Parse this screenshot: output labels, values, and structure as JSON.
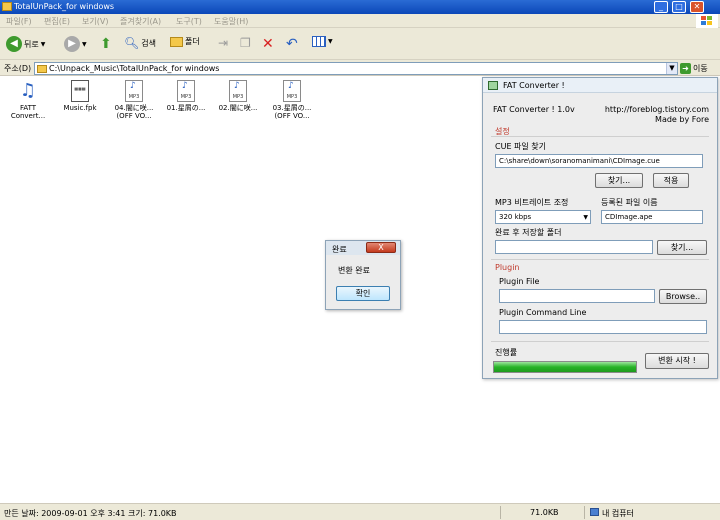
{
  "window": {
    "title": "TotalUnPack_for windows"
  },
  "menu": [
    "파일(F)",
    "편집(E)",
    "보기(V)",
    "즐겨찾기(A)",
    "도구(T)",
    "도움말(H)"
  ],
  "toolbar": {
    "back_label": "뒤로",
    "search_label": "검색",
    "folders_label": "폴더"
  },
  "address": {
    "label": "주소(D)",
    "path": "C:\\Unpack_Music\\TotalUnPack_for windows",
    "go_label": "이동"
  },
  "files": [
    {
      "name": "FATT Convert...",
      "icon": "music-notes-icon"
    },
    {
      "name": "Music.fpk",
      "icon": "fpk-file-icon"
    },
    {
      "name": "04.闇に咲...",
      "sub": "(OFF VO...",
      "icon": "mp3-file-icon"
    },
    {
      "name": "01.星屑の...",
      "icon": "mp3-file-icon"
    },
    {
      "name": "02.闇に咲...",
      "icon": "mp3-file-icon"
    },
    {
      "name": "03.星屑の...",
      "sub": "(OFF VO...",
      "icon": "mp3-file-icon"
    }
  ],
  "fat": {
    "window_title": "FAT Converter !",
    "version": "FAT Converter ! 1.0v",
    "url": "http://foreblog.tistory.com",
    "made_by": "Made by Fore",
    "settings_title": "설정",
    "cue_label": "CUE 파일 찾기",
    "cue_path": "C:\\share\\down\\soranomanimani\\CDImage.cue",
    "find_btn": "찾기...",
    "apply_btn": "적용",
    "bitrate_label": "MP3 비트레이트 조정",
    "bitrate_value": "320 kbps",
    "filename_label": "등록된 파일 이름",
    "filename_value": "CDImage.ape",
    "save_folder_label": "완료 후 저장할 폴더",
    "save_folder_value": "",
    "find_btn2": "찾기...",
    "plugin_title": "Plugin",
    "plugin_file_label": "Plugin File",
    "plugin_file_value": "",
    "browse_btn": "Browse..",
    "plugin_cmd_label": "Plugin Command Line",
    "plugin_cmd_value": "",
    "progress_label": "진행률",
    "progress_value": 1.0,
    "start_btn": "변환 시작 !"
  },
  "done_dialog": {
    "title": "완료",
    "close_label": "X",
    "message": "변환 완료",
    "ok_label": "확인"
  },
  "status": {
    "info": "만든 날짜: 2009-09-01 오후 3:41 크기: 71.0KB",
    "size": "71.0KB",
    "location": "내 컴퓨터"
  }
}
